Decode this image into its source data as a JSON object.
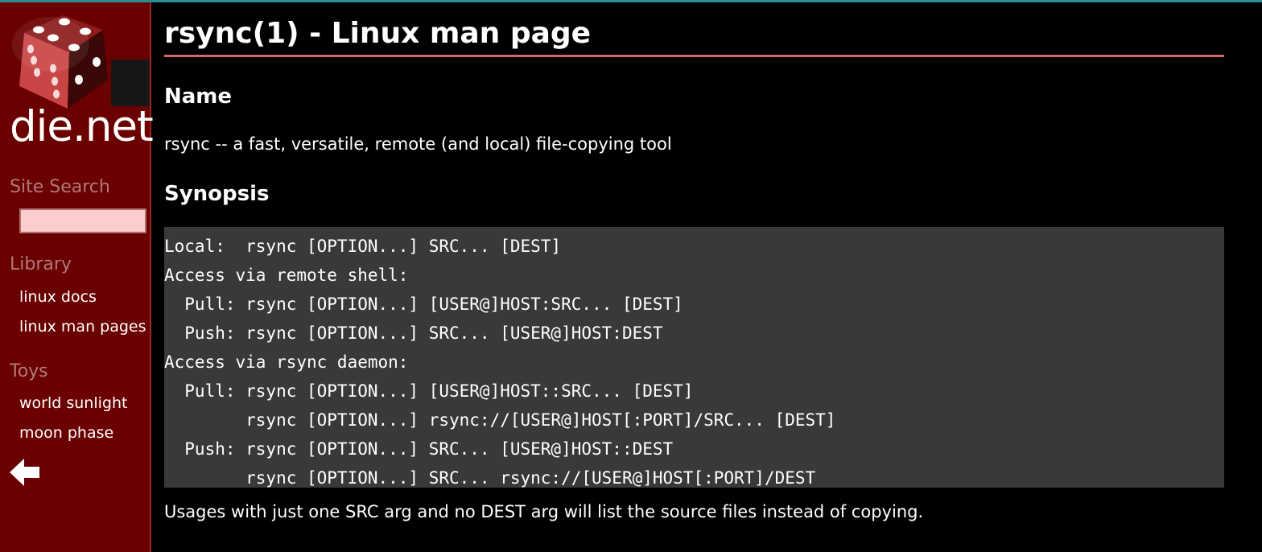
{
  "sidebar": {
    "logo_text": "die.net",
    "search_heading": "Site Search",
    "search_placeholder": "",
    "library_heading": "Library",
    "library_links": [
      "linux docs",
      "linux man pages"
    ],
    "toys_heading": "Toys",
    "toys_links": [
      "world sunlight",
      "moon phase"
    ],
    "back_icon": "left-arrow-icon"
  },
  "main": {
    "title": "rsync(1) - Linux man page",
    "name_heading": "Name",
    "name_text": "rsync -- a fast, versatile, remote (and local) file-copying tool",
    "synopsis_heading": "Synopsis",
    "synopsis_lines": [
      "Local:  rsync [OPTION...] SRC... [DEST]",
      "Access via remote shell:",
      "  Pull: rsync [OPTION...] [USER@]HOST:SRC... [DEST]",
      "  Push: rsync [OPTION...] SRC... [USER@]HOST:DEST",
      "Access via rsync daemon:",
      "  Pull: rsync [OPTION...] [USER@]HOST::SRC... [DEST]",
      "        rsync [OPTION...] rsync://[USER@]HOST[:PORT]/SRC... [DEST]",
      "  Push: rsync [OPTION...] SRC... [USER@]HOST::DEST",
      "        rsync [OPTION...] SRC... rsync://[USER@]HOST[:PORT]/DEST"
    ],
    "usage_note": "Usages with just one SRC arg and no DEST arg will list the source files instead of copying."
  },
  "colors": {
    "sidebar_bg": "#6b0000",
    "accent_rule": "#d66a6a",
    "code_bg": "#393939",
    "search_bg": "#fbcdcd"
  }
}
